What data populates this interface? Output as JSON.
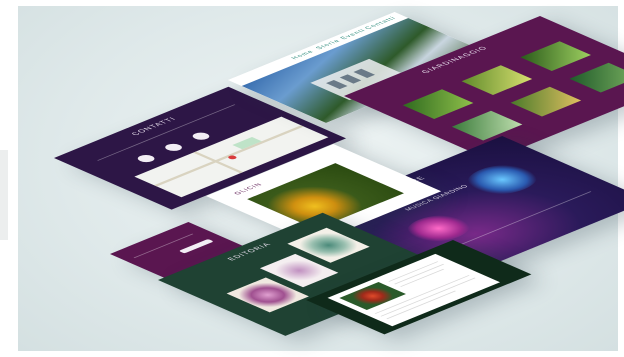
{
  "cards": {
    "contatti": {
      "title": "CONTATTI"
    },
    "giardino": {
      "nav": [
        "Home",
        "Storia",
        "Eventi",
        "Contatti"
      ]
    },
    "giardinaggio": {
      "title": "GIARDINAGGIO"
    },
    "glicin": {
      "title": "GLICIN"
    },
    "store": {
      "title": "STORE",
      "subtitle": "MUSICA GIARDINO"
    },
    "editoria": {
      "title": "EDITORIA"
    }
  },
  "colors": {
    "background": "#dfe9ea",
    "deep_purple": "#2d1646",
    "plum": "#5a1650",
    "forest": "#1f4233",
    "violet": "#2a1a5a",
    "dark_green": "#0f2a1a"
  }
}
